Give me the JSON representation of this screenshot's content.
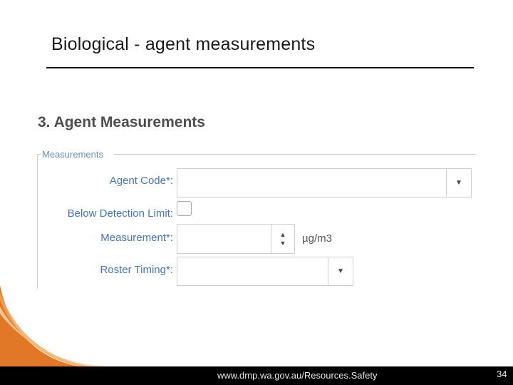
{
  "slide": {
    "title": "Biological - agent measurements"
  },
  "form": {
    "section_heading": "3. Agent Measurements",
    "legend": "Measurements",
    "fields": {
      "agent_code": {
        "label": "Agent Code*:",
        "value": ""
      },
      "below_detection_limit": {
        "label": "Below Detection Limit:",
        "checked": false
      },
      "measurement": {
        "label": "Measurement*:",
        "value": "",
        "unit": "µg/m3"
      },
      "roster_timing": {
        "label": "Roster Timing*:",
        "value": ""
      }
    },
    "icons": {
      "dropdown": "triangle-down",
      "spin_up": "triangle-up",
      "spin_down": "triangle-down"
    }
  },
  "footer": {
    "url": "www.dmp.wa.gov.au/Resources.Safety",
    "page_number": "34"
  },
  "colors": {
    "label_blue": "#4a74b8",
    "heading_gray": "#4d4d4d",
    "footer_bg": "#000000",
    "swoosh_orange": "#e07828"
  }
}
